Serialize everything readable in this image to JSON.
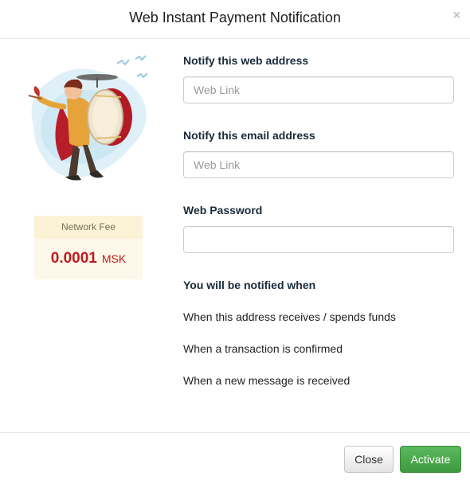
{
  "dialog": {
    "title": "Web Instant Payment Notification",
    "close_symbol": "×"
  },
  "illustration": {
    "icon": "drummer-mascot-illustration"
  },
  "network_fee": {
    "label": "Network Fee",
    "amount": "0.0001",
    "unit": "MSK",
    "color": "#c0191f"
  },
  "form": {
    "web_address": {
      "label": "Notify this web address",
      "placeholder": "Web Link",
      "value": ""
    },
    "email_address": {
      "label": "Notify this email address",
      "placeholder": "Web Link",
      "value": ""
    },
    "web_password": {
      "label": "Web Password",
      "value": ""
    },
    "notify_heading": "You will be notified when",
    "notify_items": [
      "When this address receives / spends funds",
      "When a transaction is confirmed",
      "When a new message is received"
    ]
  },
  "footer": {
    "close_label": "Close",
    "activate_label": "Activate",
    "activate_color": "#4cae4c"
  }
}
